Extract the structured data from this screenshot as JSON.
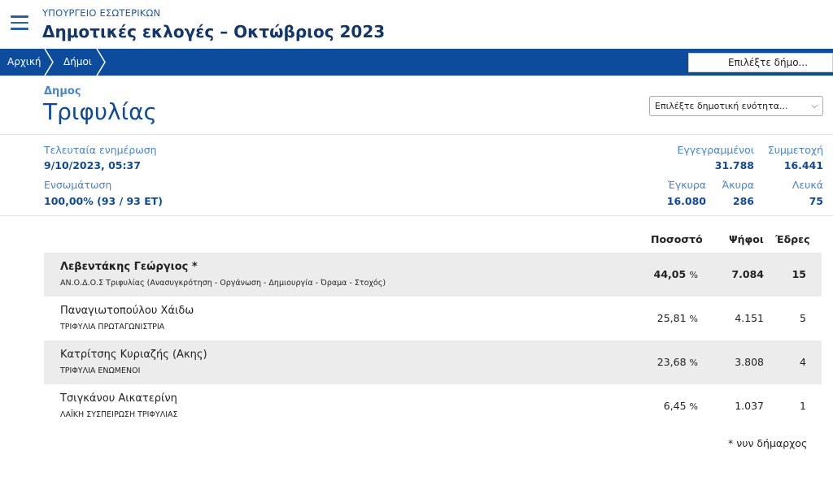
{
  "header": {
    "ministry": "ΥΠΟΥΡΓΕΙΟ ΕΣΩΤΕΡΙΚΩΝ",
    "title": "Δημοτικές εκλογές – Οκτώβριος 2023"
  },
  "nav": {
    "breadcrumbs": [
      "Αρχική",
      "Δήμοι"
    ],
    "municipality_select": "Επιλέξτε δήμο..."
  },
  "municipality": {
    "label": "Δημος",
    "name": "Τριφυλίας",
    "unit_select": "Επιλέξτε δημοτική ενότητα..."
  },
  "info": {
    "last_update_label": "Τελευταία ενημέρωση",
    "last_update_value": "9/10/2023, 05:37",
    "integration_label": "Ενσωμάτωση",
    "integration_value": "100,00% (93 / 93 ΕΤ)",
    "registered_label": "Εγγεγραμμένοι",
    "registered_value": "31.788",
    "turnout_label": "Συμμετοχή",
    "turnout_value": "16.441",
    "valid_label": "Έγκυρα",
    "valid_value": "16.080",
    "invalid_label": "Άκυρα",
    "invalid_value": "286",
    "blank_label": "Λευκά",
    "blank_value": "75"
  },
  "results": {
    "columns": {
      "percent": "Ποσοστό",
      "votes": "Ψήφοι",
      "seats": "Έδρες"
    },
    "percent_symbol": "%",
    "rows": [
      {
        "name": "Λεβεντάκης Γεώργιος *",
        "party": "ΑΝ.Ο.Δ.Ο.Σ Τριφυλίας (Ανασυγκρότηση - Οργάνωση - Δημιουργία - Όραμα - Στοχός)",
        "percent": "44,05",
        "votes": "7.084",
        "seats": "15"
      },
      {
        "name": "Παναγιωτοπούλου Χάιδω",
        "party": "ΤΡΙΦΥΛΙΑ ΠΡΩΤΑΓΩΝΙΣΤΡΙΑ",
        "percent": "25,81",
        "votes": "4.151",
        "seats": "5"
      },
      {
        "name": "Κατρίτσης Κυριαζής (Ακης)",
        "party": "ΤΡΙΦΥΛΙΑ ΕΝΩΜΕΝΟΙ",
        "percent": "23,68",
        "votes": "3.808",
        "seats": "4"
      },
      {
        "name": "Τσιγκάνου Αικατερίνη",
        "party": "ΛΑΪΚΗ ΣΥΣΠΕΙΡΩΣΗ ΤΡΙΦΥΛΙΑΣ",
        "percent": "6,45",
        "votes": "1.037",
        "seats": "1"
      }
    ],
    "footnote": "* νυν δήμαρχος"
  },
  "colors": {
    "primary": "#0d4c9d",
    "title": "#13366b",
    "accent": "#4a83c9",
    "row_shade": "#ececec"
  }
}
